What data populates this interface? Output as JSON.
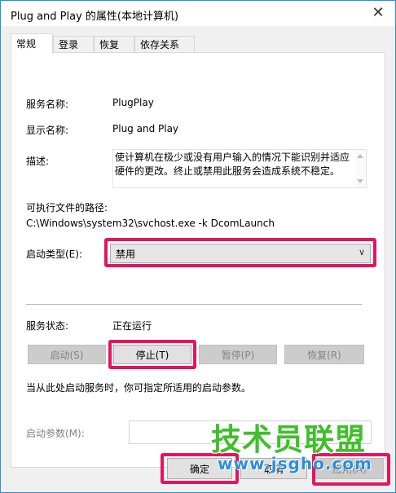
{
  "window": {
    "title": "Plug and Play 的属性(本地计算机)",
    "close_glyph": "✕"
  },
  "tabs": [
    {
      "label": "常规",
      "active": true
    },
    {
      "label": "登录",
      "active": false
    },
    {
      "label": "恢复",
      "active": false
    },
    {
      "label": "依存关系",
      "active": false
    }
  ],
  "general": {
    "service_name_label": "服务名称:",
    "service_name": "PlugPlay",
    "display_name_label": "显示名称:",
    "display_name": "Plug and Play",
    "description_label": "描述:",
    "description": "使计算机在极少或没有用户输入的情况下能识别并适应硬件的更改。终止或禁用此服务会造成系统不稳定。",
    "exe_path_label": "可执行文件的路径:",
    "exe_path": "C:\\Windows\\system32\\svchost.exe -k DcomLaunch",
    "startup_type_label": "启动类型(E):",
    "startup_type_value": "禁用",
    "service_status_label": "服务状态:",
    "service_status": "正在运行",
    "start_button": "启动(S)",
    "stop_button": "停止(T)",
    "pause_button": "暂停(P)",
    "resume_button": "恢复(R)",
    "hint_text": "当从此处启动服务时，你可指定所适用的启动参数。",
    "start_params_label": "启动参数(M):",
    "start_params_value": ""
  },
  "footer": {
    "ok_button": "确定",
    "cancel_button": "取消",
    "apply_button": "应用(A)"
  },
  "watermark": {
    "main": "技术员联盟",
    "sub": "www.jsgho.com"
  },
  "colors": {
    "highlight": "#e6135f",
    "window_border": "#2b8fd6",
    "watermark_green": "#3fbf2c",
    "watermark_blue": "#2d8fd5"
  }
}
